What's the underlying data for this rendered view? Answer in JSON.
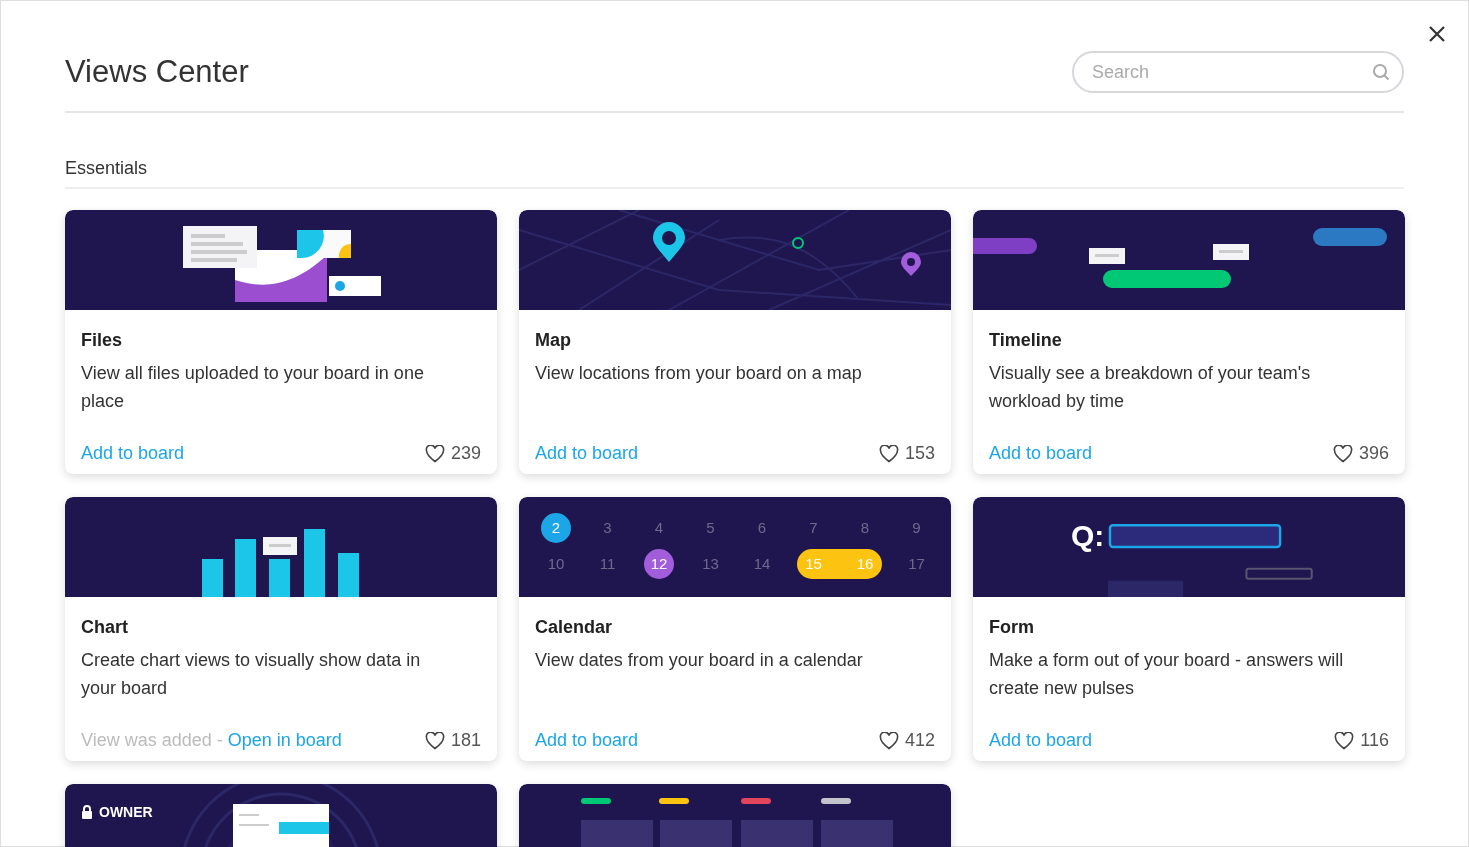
{
  "title": "Views Center",
  "search": {
    "placeholder": "Search"
  },
  "section": "Essentials",
  "cards": [
    {
      "kind": "files",
      "title": "Files",
      "description": "View all files uploaded to your board in one place",
      "action": "Add to board",
      "likes": "239"
    },
    {
      "kind": "map",
      "title": "Map",
      "description": "View locations from your board on a map",
      "action": "Add to board",
      "likes": "153"
    },
    {
      "kind": "timeline",
      "title": "Timeline",
      "description": "Visually see a breakdown of your team's workload by time",
      "action": "Add to board",
      "likes": "396"
    },
    {
      "kind": "chart",
      "title": "Chart",
      "description": "Create chart views to visually show data in your board",
      "status": "View was added - ",
      "action": "Open in board",
      "likes": "181"
    },
    {
      "kind": "calendar",
      "title": "Calendar",
      "description": "View dates from your board in a calendar",
      "action": "Add to board",
      "likes": "412",
      "days": [
        {
          "label": "2",
          "kind": "circle",
          "color": "#1ca6e8"
        },
        {
          "label": "3",
          "kind": "plain"
        },
        {
          "label": "4",
          "kind": "plain"
        },
        {
          "label": "5",
          "kind": "plain"
        },
        {
          "label": "6",
          "kind": "plain"
        },
        {
          "label": "7",
          "kind": "plain"
        },
        {
          "label": "8",
          "kind": "plain"
        },
        {
          "label": "9",
          "kind": "plain"
        },
        {
          "label": "10",
          "kind": "plain"
        },
        {
          "label": "11",
          "kind": "plain"
        },
        {
          "label": "12",
          "kind": "circle",
          "color": "#a25ddc"
        },
        {
          "label": "13",
          "kind": "plain"
        },
        {
          "label": "14",
          "kind": "plain"
        },
        {
          "label": "15",
          "kind": "start",
          "color": "#fdc311"
        },
        {
          "label": "16",
          "kind": "end",
          "color": "#fdc311"
        },
        {
          "label": "17",
          "kind": "plain"
        }
      ]
    },
    {
      "kind": "form",
      "title": "Form",
      "description": "Make a form out of your board - answers will create new pulses",
      "action": "Add to board",
      "likes": "116",
      "question": "Q:"
    },
    {
      "kind": "owner",
      "badge": "OWNER"
    },
    {
      "kind": "kanban"
    }
  ]
}
